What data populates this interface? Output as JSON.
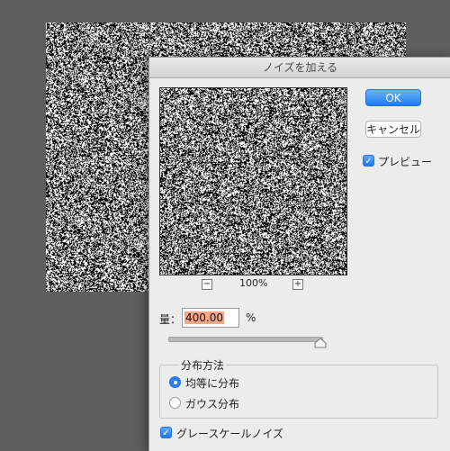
{
  "dialog": {
    "title": "ノイズを加える",
    "ok_label": "OK",
    "cancel_label": "キャンセル",
    "preview_label": "プレビュー",
    "preview_checked": true
  },
  "preview": {
    "zoom_out_label": "−",
    "zoom_level": "100%",
    "zoom_in_label": "+"
  },
  "amount": {
    "label": "量：",
    "value": "400.00",
    "unit": "%",
    "slider_fraction": 1.0
  },
  "distribution": {
    "title": "分布方法",
    "options": [
      {
        "label": "均等に分布",
        "selected": true
      },
      {
        "label": "ガウス分布",
        "selected": false
      }
    ]
  },
  "monochrome": {
    "label": "グレースケールノイズ",
    "checked": true
  },
  "colors": {
    "accent": "#2a7ef0",
    "highlight": "#f5a683",
    "background": "#5e5e5e"
  },
  "icons": {
    "check": "check-icon"
  }
}
